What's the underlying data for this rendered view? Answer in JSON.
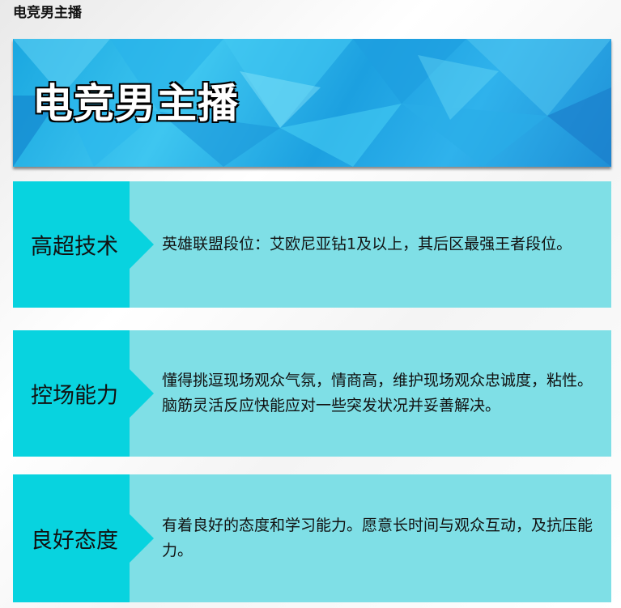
{
  "page": {
    "title": "电竞男主播"
  },
  "banner": {
    "title": "电竞男主播"
  },
  "cards": [
    {
      "label": "高超技术",
      "text": "英雄联盟段位：艾欧尼亚钻1及以上，其后区最强王者段位。"
    },
    {
      "label": "控场能力",
      "text": "懂得挑逗现场观众气氛，情商高，维护现场观众忠诚度，粘性。脑筋灵活反应快能应对一些突发状况并妥善解决。"
    },
    {
      "label": "良好态度",
      "text": "有着良好的态度和学习能力。愿意长时间与观众互动，及抗压能力。"
    }
  ],
  "colors": {
    "label_box": "#08d3df",
    "card_body": "#7fdfe6",
    "banner_blue": "#1aa7e0"
  }
}
